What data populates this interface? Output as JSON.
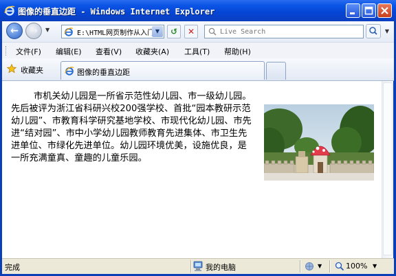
{
  "window": {
    "title": "图像的垂直边距 - Windows Internet Explorer"
  },
  "address": {
    "url": "E:\\HTML网页制作从入门到精通"
  },
  "search": {
    "placeholder": "Live Search"
  },
  "menu": {
    "items": [
      {
        "label": "文件(F)"
      },
      {
        "label": "编辑(E)"
      },
      {
        "label": "查看(V)"
      },
      {
        "label": "收藏夹(A)"
      },
      {
        "label": "工具(T)"
      },
      {
        "label": "帮助(H)"
      }
    ]
  },
  "favorites": {
    "label": "收藏夹"
  },
  "tab": {
    "title": "图像的垂直边距"
  },
  "page": {
    "paragraph": "市机关幼儿园是一所省示范性幼儿园、市一级幼儿园。先后被评为浙江省科研兴校200强学校、首批“园本教研示范幼儿园”、市教育科学研究基地学校、市现代化幼儿园、市先进“结对园”、市中小学幼儿园教师教育先进集体、市卫生先进单位、市绿化先进单位。幼儿园环境优美，设施优良，是一所充满童真、童趣的儿童乐园。",
    "image_alt": "幼儿园图片"
  },
  "status": {
    "text": "完成",
    "zone": "我的电脑",
    "zoom": "100%"
  }
}
